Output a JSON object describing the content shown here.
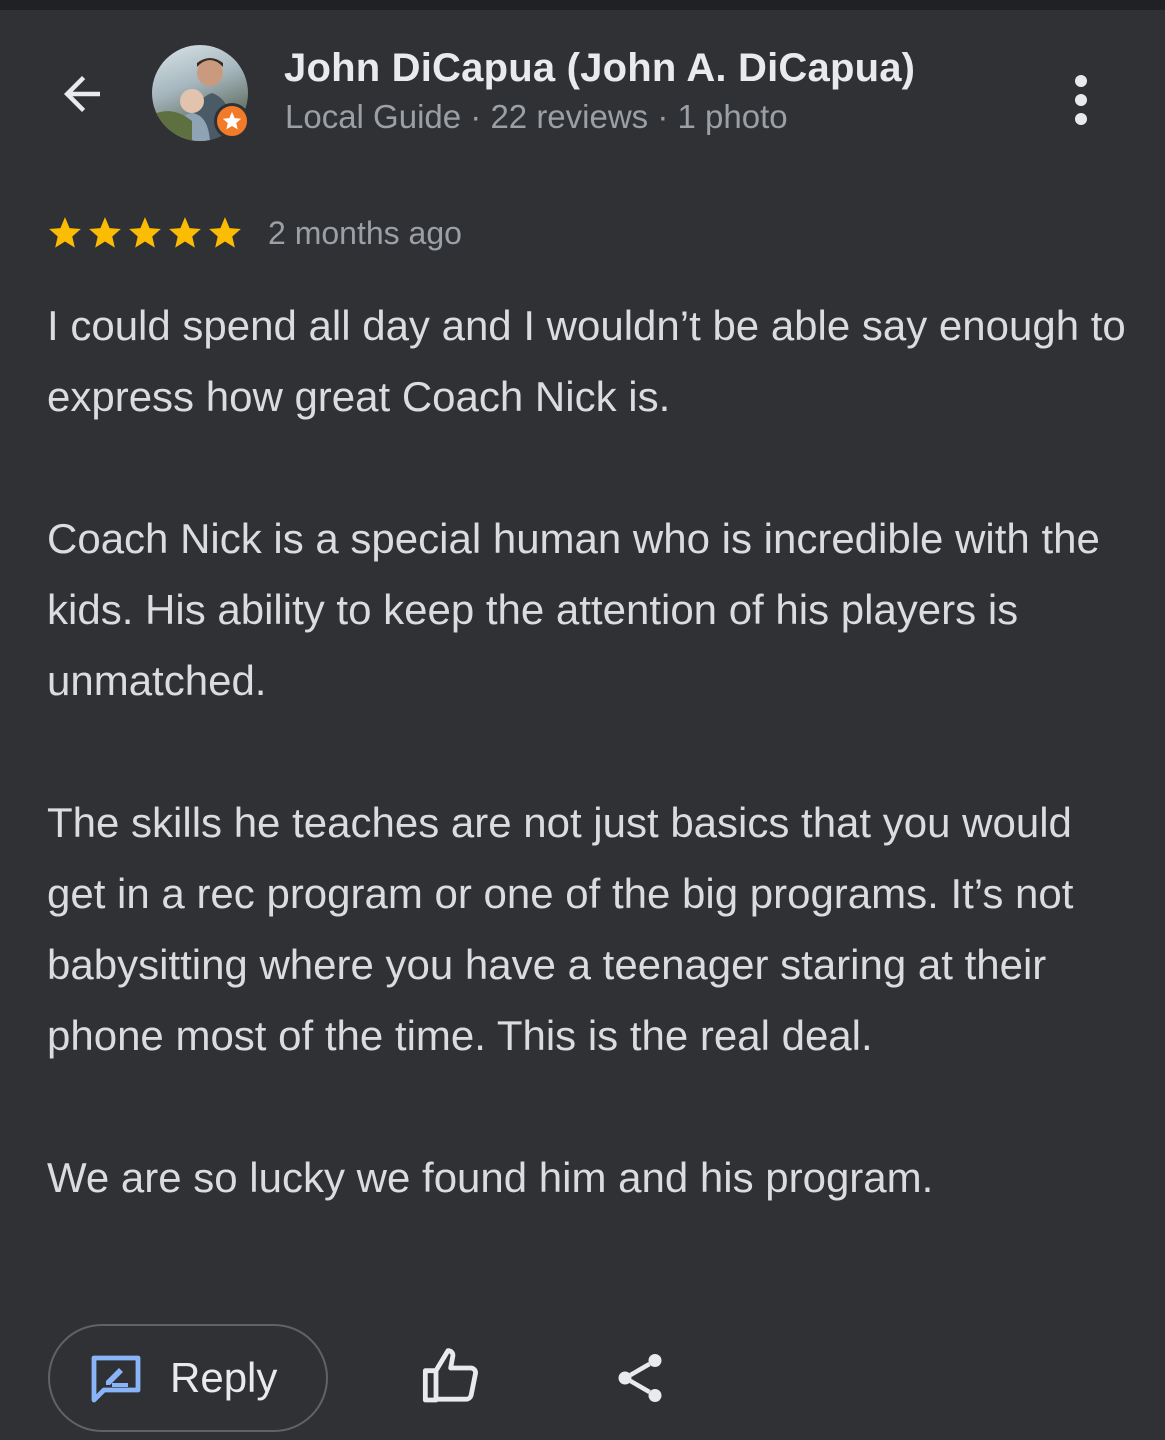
{
  "header": {
    "user_name": "John DiCapua (John A. DiCapua)",
    "user_meta": "Local Guide · 22 reviews · 1 photo"
  },
  "review": {
    "rating": 5,
    "rating_max": 5,
    "date": "2 months ago",
    "paragraphs": [
      "I could spend all day and I wouldn’t be able say enough to express how great Coach Nick is.",
      "Coach Nick is a special human who is incredible with the kids. His ability to keep the attention of his players is unmatched.",
      "The skills he teaches are not just basics that you would get in a rec program or one of the big programs. It’s not babysitting where you have a teenager staring at their phone most of the time. This is the real deal.",
      "We are so lucky we found him and his program."
    ]
  },
  "actions": {
    "reply_label": "Reply"
  },
  "icons": {
    "back": "arrow-back-icon",
    "more": "more-vert-icon",
    "star": "star-icon",
    "reply": "reply-edit-icon",
    "like": "thumb-up-icon",
    "share": "share-icon",
    "badge": "local-guide-star-icon"
  },
  "colors": {
    "background": "#303134",
    "star": "#fbbc04",
    "badge": "#f27b2a",
    "reply_icon": "#8ab4f8"
  }
}
